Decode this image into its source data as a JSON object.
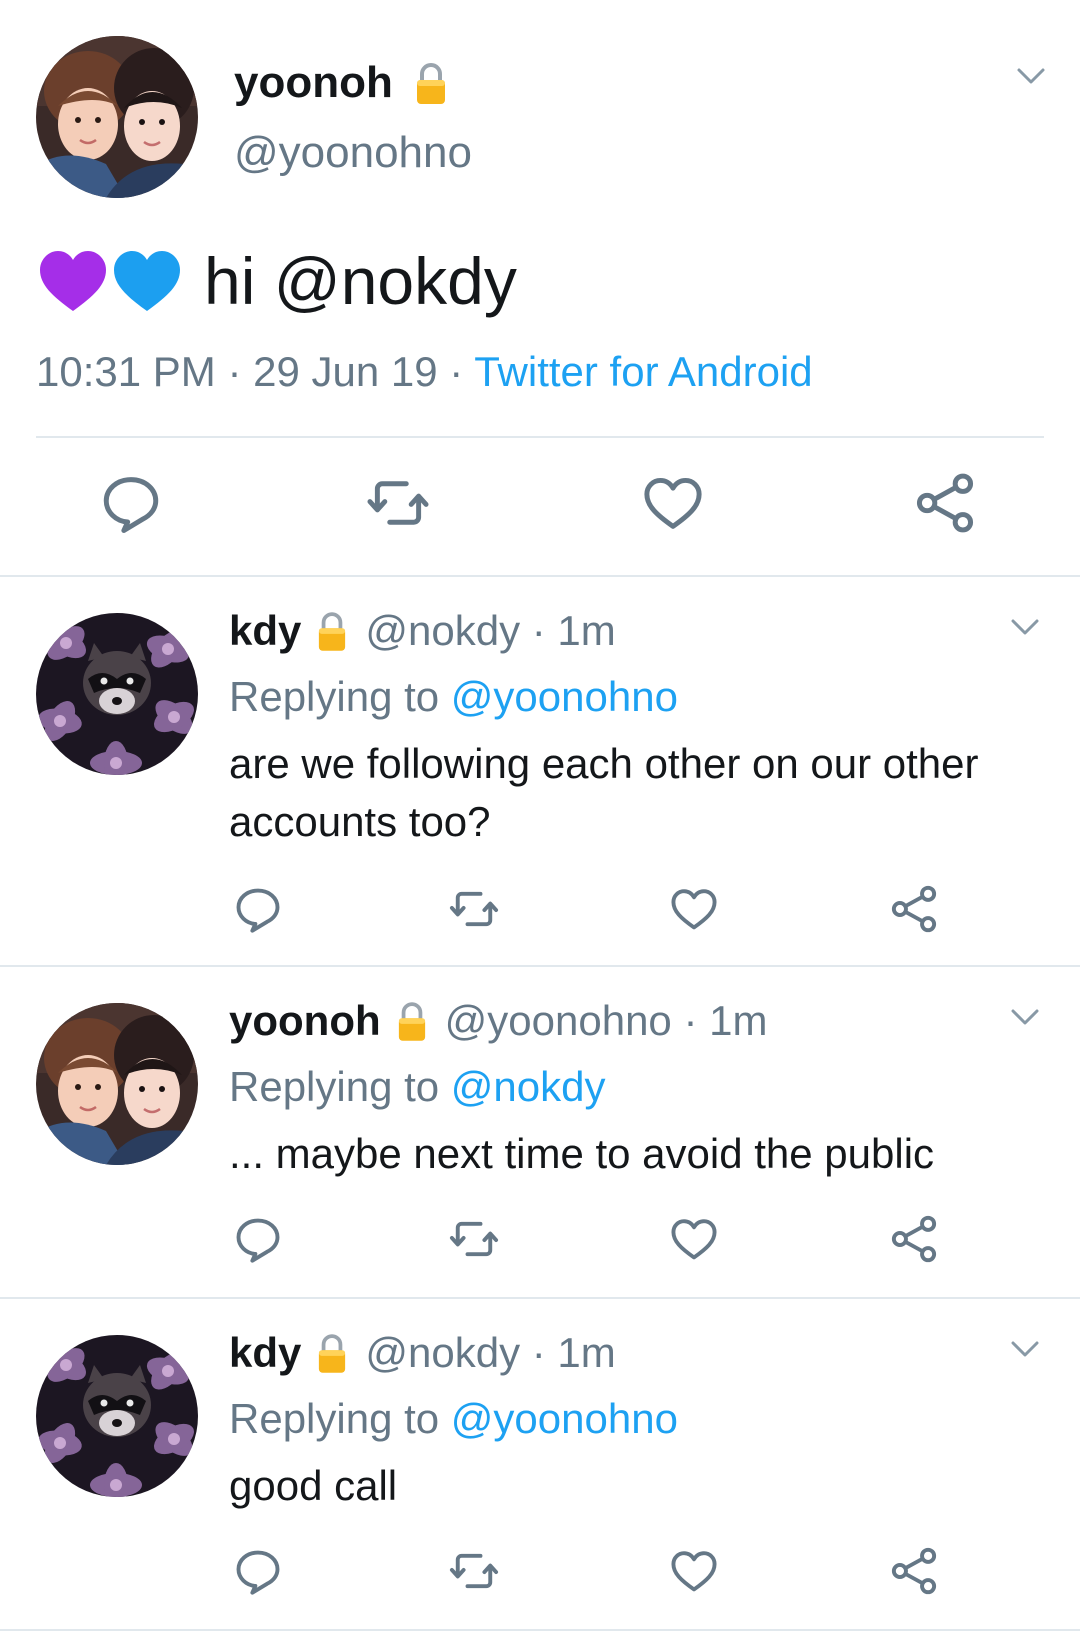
{
  "main_tweet": {
    "name": "yoonoh",
    "handle": "@yoonohno",
    "emoji_hearts": [
      "purple-heart",
      "blue-heart"
    ],
    "text_prefix": "hi ",
    "mention": "@nokdy",
    "time": "10:31 PM",
    "date": "29 Jun 19",
    "source": "Twitter for Android",
    "separator": " · "
  },
  "replies": [
    {
      "name": "kdy",
      "handle": "@nokdy",
      "age": "1m",
      "replying_label": "Replying to ",
      "replying_to": "@yoonohno",
      "text": "are we following each other on our other accounts too?"
    },
    {
      "name": "yoonoh",
      "handle": "@yoonohno",
      "age": "1m",
      "replying_label": "Replying to ",
      "replying_to": "@nokdy",
      "text": "... maybe next time to avoid the public"
    },
    {
      "name": "kdy",
      "handle": "@nokdy",
      "age": "1m",
      "replying_label": "Replying to ",
      "replying_to": "@yoonohno",
      "text": "good call"
    }
  ],
  "icons": {
    "lock": "lock-icon",
    "chevron": "chevron-down-icon",
    "reply": "reply-icon",
    "retweet": "retweet-icon",
    "like": "heart-icon",
    "share": "share-icon"
  },
  "colors": {
    "link": "#1da1f2",
    "secondary_text": "#657786",
    "divider": "#e1e8ed",
    "lock": "#f5b417"
  }
}
